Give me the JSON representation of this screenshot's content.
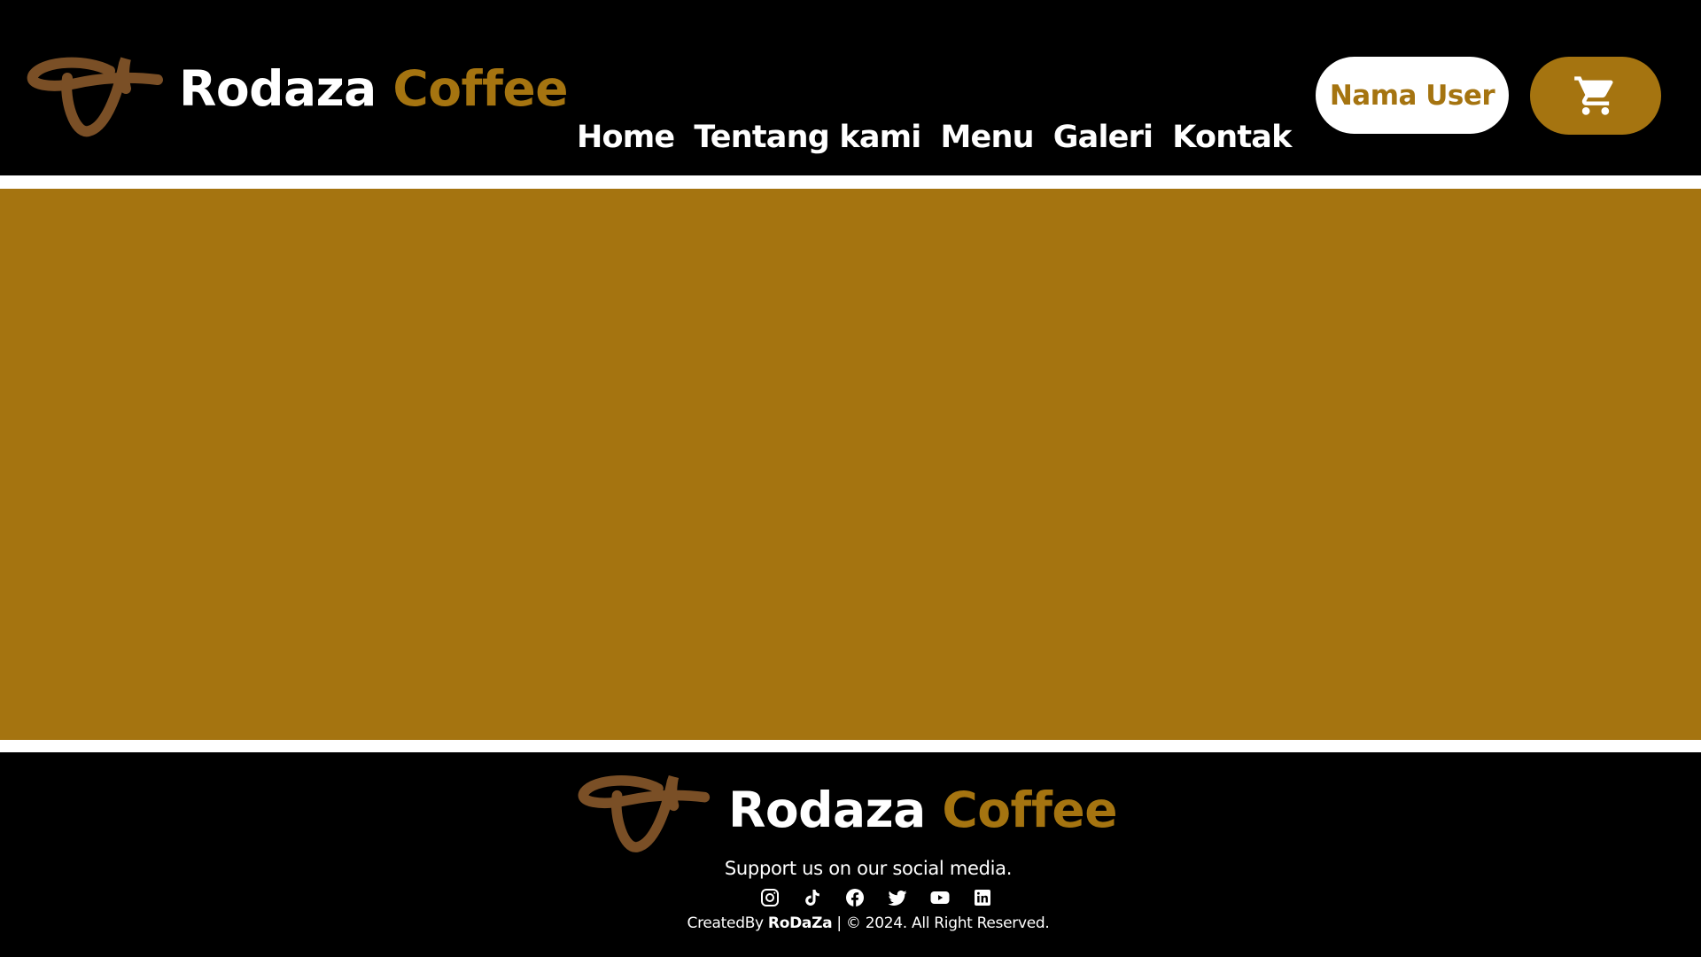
{
  "colors": {
    "background": "#000000",
    "accent": "#a57410",
    "logo": "#7a4f26",
    "white": "#ffffff"
  },
  "header": {
    "logo_icon": "coffee-swirl-logo",
    "brand_word1": "Rodaza",
    "brand_word2": "Coffee",
    "nav": [
      {
        "label": "Home"
      },
      {
        "label": "Tentang kami"
      },
      {
        "label": "Menu"
      },
      {
        "label": "Galeri"
      },
      {
        "label": "Kontak"
      }
    ],
    "user_button_label": "Nama User",
    "cart_icon": "shopping-cart-icon"
  },
  "footer": {
    "logo_icon": "coffee-swirl-logo",
    "brand_word1": "Rodaza",
    "brand_word2": "Coffee",
    "support_text": "Support us on our social media.",
    "social_icons": [
      "instagram-icon",
      "tiktok-icon",
      "facebook-icon",
      "twitter-icon",
      "youtube-icon",
      "linkedin-icon"
    ],
    "created_prefix": "CreatedBy ",
    "created_name": "RoDaZa",
    "created_suffix": " | © 2024. All Right Reserved."
  }
}
